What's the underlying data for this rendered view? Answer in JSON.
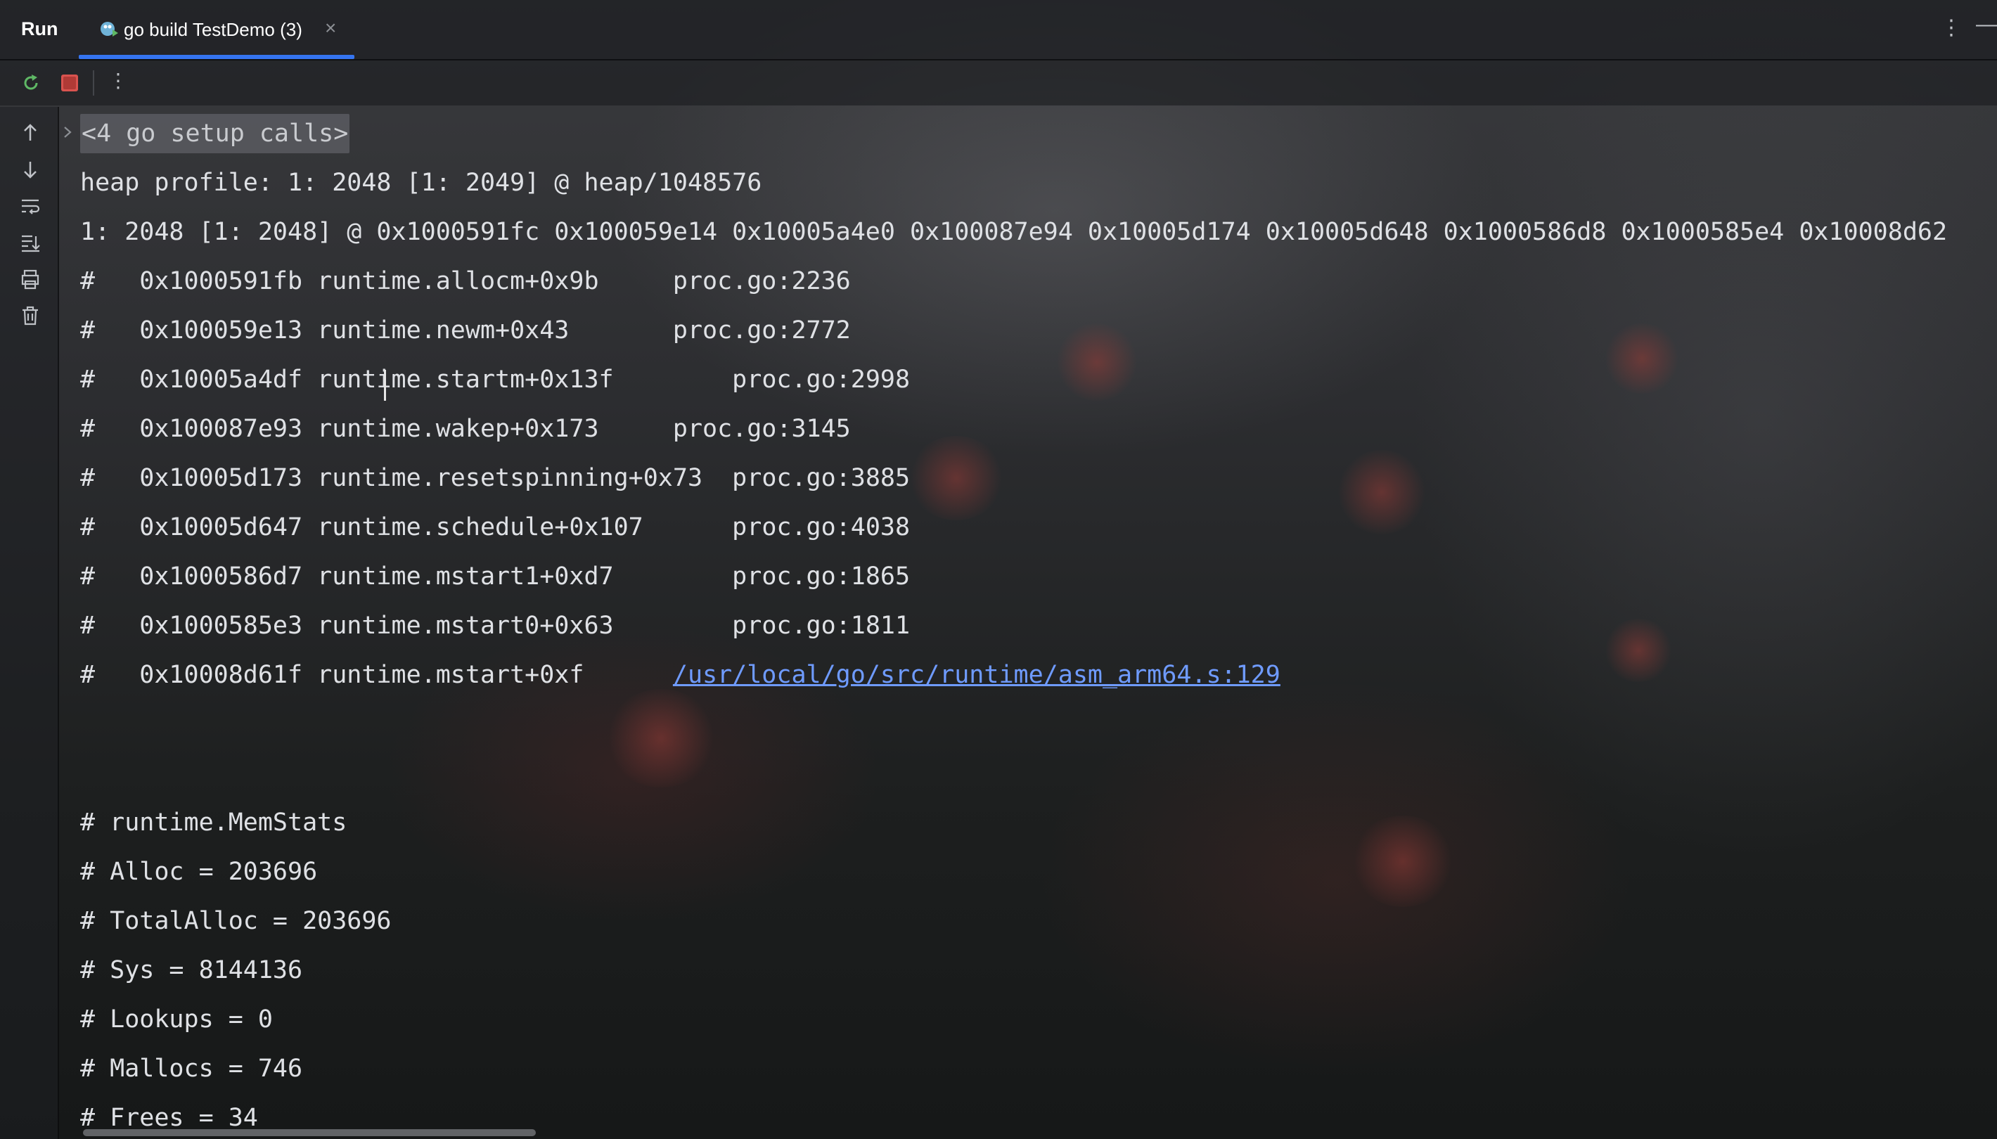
{
  "title_bar": {
    "run_label": "Run",
    "tab_label": "go build TestDemo (3)",
    "tab_close": "×",
    "more_icon": "kebab-vertical-icon",
    "minimize_icon": "minimize-icon"
  },
  "toolbar": {
    "icons": [
      "rerun-icon",
      "stop-icon",
      "kebab-vertical-icon"
    ]
  },
  "gutter": {
    "icons": [
      "arrow-up-icon",
      "arrow-down-icon",
      "soft-wrap-icon",
      "scroll-to-end-icon",
      "print-icon",
      "trash-icon"
    ]
  },
  "colors": {
    "accent": "#3574f0",
    "stop": "#d9534f",
    "rerun": "#5fb865",
    "link": "#6f9bff"
  },
  "console": {
    "folded": "<4 go setup calls>",
    "heap_line": "heap profile: 1: 2048 [1: 2049] @ heap/1048576",
    "sample_line": "1: 2048 [1: 2048] @ 0x1000591fc 0x100059e14 0x10005a4e0 0x100087e94 0x10005d174 0x10005d648 0x1000586d8 0x1000585e4 0x10008d62",
    "stack": [
      {
        "prefix": "#   0x1000591fb runtime.allocm+0x9b     ",
        "loc": "proc.go:2236"
      },
      {
        "prefix": "#   0x100059e13 runtime.newm+0x43       ",
        "loc": "proc.go:2772"
      },
      {
        "prefix": "#   0x10005a4df runtime.startm+0x13f        ",
        "loc": "proc.go:2998"
      },
      {
        "prefix": "#   0x100087e93 runtime.wakep+0x173     ",
        "loc": "proc.go:3145"
      },
      {
        "prefix": "#   0x10005d173 runtime.resetspinning+0x73  ",
        "loc": "proc.go:3885"
      },
      {
        "prefix": "#   0x10005d647 runtime.schedule+0x107      ",
        "loc": "proc.go:4038"
      },
      {
        "prefix": "#   0x1000586d7 runtime.mstart1+0xd7        ",
        "loc": "proc.go:1865"
      },
      {
        "prefix": "#   0x1000585e3 runtime.mstart0+0x63        ",
        "loc": "proc.go:1811"
      },
      {
        "prefix": "#   0x10008d61f runtime.mstart+0xf      ",
        "loc": "/usr/local/go/src/runtime/asm_arm64.s:129"
      }
    ],
    "memstats": [
      "# runtime.MemStats",
      "# Alloc = 203696",
      "# TotalAlloc = 203696",
      "# Sys = 8144136",
      "# Lookups = 0",
      "# Mallocs = 746",
      "# Frees = 34"
    ]
  }
}
